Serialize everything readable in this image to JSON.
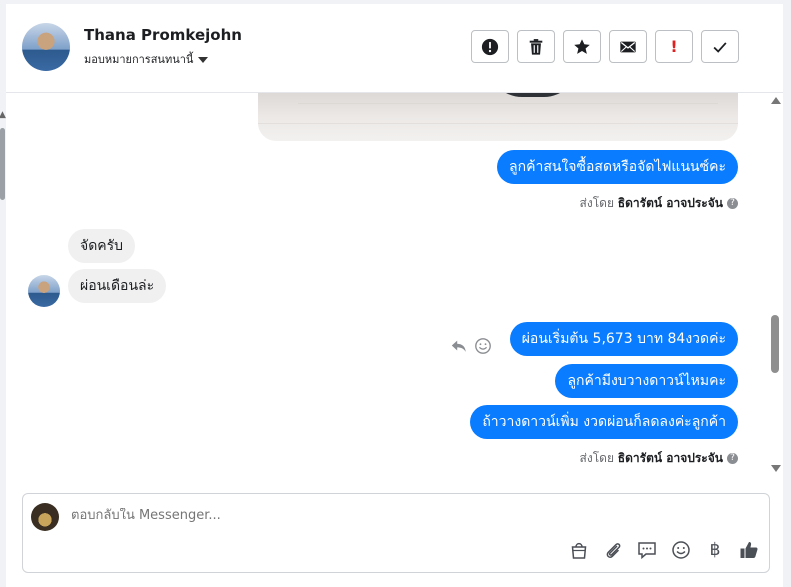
{
  "header": {
    "contact_name": "Thana Promkejohn",
    "assign_label": "มอบหมายการสนทนานี้",
    "actions": [
      {
        "name": "spam-button",
        "icon": "alert-circle-icon"
      },
      {
        "name": "delete-button",
        "icon": "trash-icon"
      },
      {
        "name": "star-button",
        "icon": "star-icon"
      },
      {
        "name": "mark-unread-button",
        "icon": "envelope-icon"
      },
      {
        "name": "follow-up-button",
        "icon": "exclamation-icon",
        "text": "!"
      },
      {
        "name": "mark-done-button",
        "icon": "check-icon"
      }
    ]
  },
  "thread": {
    "messages": [
      {
        "dir": "out",
        "text": "ลูกค้าสนใจซื้อสดหรือจัดไฟแนนซ์คะ"
      },
      {
        "dir": "in",
        "text": "จัดครับ"
      },
      {
        "dir": "in",
        "text": "ผ่อนเดือนล่ะ"
      },
      {
        "dir": "out",
        "text": "ผ่อนเริ่มต้น 5,673 บาท 84งวดค่ะ"
      },
      {
        "dir": "out",
        "text": "ลูกค้ามีงบวางดาวน์ไหมคะ"
      },
      {
        "dir": "out",
        "text": "ถ้าวางดาวน์เพิ่ม งวดผ่อนก็ลดลงค่ะลูกค้า"
      }
    ],
    "sent_by_prefix": "ส่งโดย",
    "sent_by_name": "ธิดารัตน์ อาจประจัน",
    "help_glyph": "?"
  },
  "composer": {
    "placeholder": "ตอบกลับใน Messenger...",
    "baht_symbol": "฿",
    "tools": [
      "shopping-bag-icon",
      "paperclip-icon",
      "chat-bubble-icon",
      "smiley-icon",
      "baht-icon",
      "thumbs-up-icon"
    ]
  },
  "colors": {
    "outgoing_bubble": "#0a7cff",
    "incoming_bubble": "#f0f0f0",
    "accent_red": "#e02020"
  }
}
